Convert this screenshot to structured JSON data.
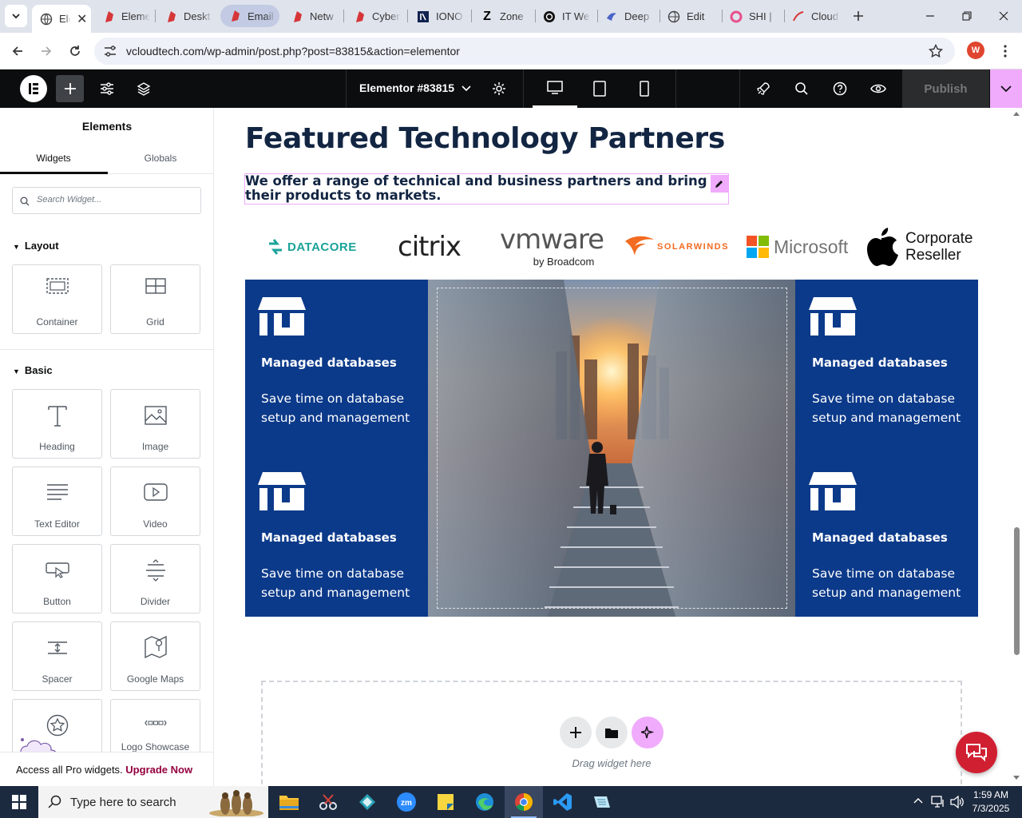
{
  "browser": {
    "tabs": [
      {
        "label": "Ele",
        "icon": "elementor-icon",
        "active": true
      },
      {
        "label": "Eleme",
        "icon": "elementor-red-icon"
      },
      {
        "label": "Deskt",
        "icon": "elementor-red-icon"
      },
      {
        "label": "Email",
        "icon": "elementor-red-icon",
        "highlight": true
      },
      {
        "label": "Netw",
        "icon": "elementor-red-icon"
      },
      {
        "label": "Cyber",
        "icon": "elementor-red-icon"
      },
      {
        "label": "IONO",
        "icon": "ionos-icon"
      },
      {
        "label": "Zone",
        "icon": "z-icon"
      },
      {
        "label": "IT We",
        "icon": "openai-icon"
      },
      {
        "label": "Deep",
        "icon": "deepl-icon"
      },
      {
        "label": "Edit",
        "icon": "globe-icon"
      },
      {
        "label": "SHI |",
        "icon": "shi-icon"
      },
      {
        "label": "Cloud",
        "icon": "cloud-icon"
      }
    ],
    "url": "vcloudtech.com/wp-admin/post.php?post=83815&action=elementor",
    "avatar_letter": "W"
  },
  "editor": {
    "document_title": "Elementor #83815",
    "publish_label": "Publish"
  },
  "panel": {
    "title": "Elements",
    "tabs": [
      "Widgets",
      "Globals"
    ],
    "search_placeholder": "Search Widget...",
    "layout_title": "Layout",
    "basic_title": "Basic",
    "layout_widgets": [
      "Container",
      "Grid"
    ],
    "basic_widgets": [
      "Heading",
      "Image",
      "Text Editor",
      "Video",
      "Button",
      "Divider",
      "Spacer",
      "Google Maps",
      "",
      "Logo Showcase"
    ],
    "upgrade_text": "Access all Pro widgets.",
    "upgrade_link": "Upgrade Now"
  },
  "page": {
    "heading": "Featured Technology Partners",
    "subheading": "We offer a range of technical and business partners and bring their products to markets.",
    "logos": {
      "datacore": "DATACORE",
      "citrix": "citrix",
      "vmware": "vmware",
      "vmware_sub": "by Broadcom",
      "solarwinds": "SOLARWINDS",
      "microsoft": "Microsoft",
      "apple_line1": "Corporate",
      "apple_line2": "Reseller"
    },
    "cards": [
      {
        "title": "Managed databases",
        "text": "Save time on database setup and management"
      },
      {
        "title": "Managed databases",
        "text": "Save time on database setup and management"
      },
      {
        "title": "Managed databases",
        "text": "Save time on database setup and management"
      },
      {
        "title": "Managed databases",
        "text": "Save time on database setup and management"
      }
    ],
    "drop_text": "Drag widget here"
  },
  "taskbar": {
    "search_placeholder": "Type here to search",
    "time": "1:59 AM",
    "date": "7/3/2025"
  },
  "colors": {
    "elementor_pink": "#f0abfc",
    "card_blue": "#0c3a8a",
    "heading_navy": "#122542",
    "upgrade": "#93003f"
  }
}
